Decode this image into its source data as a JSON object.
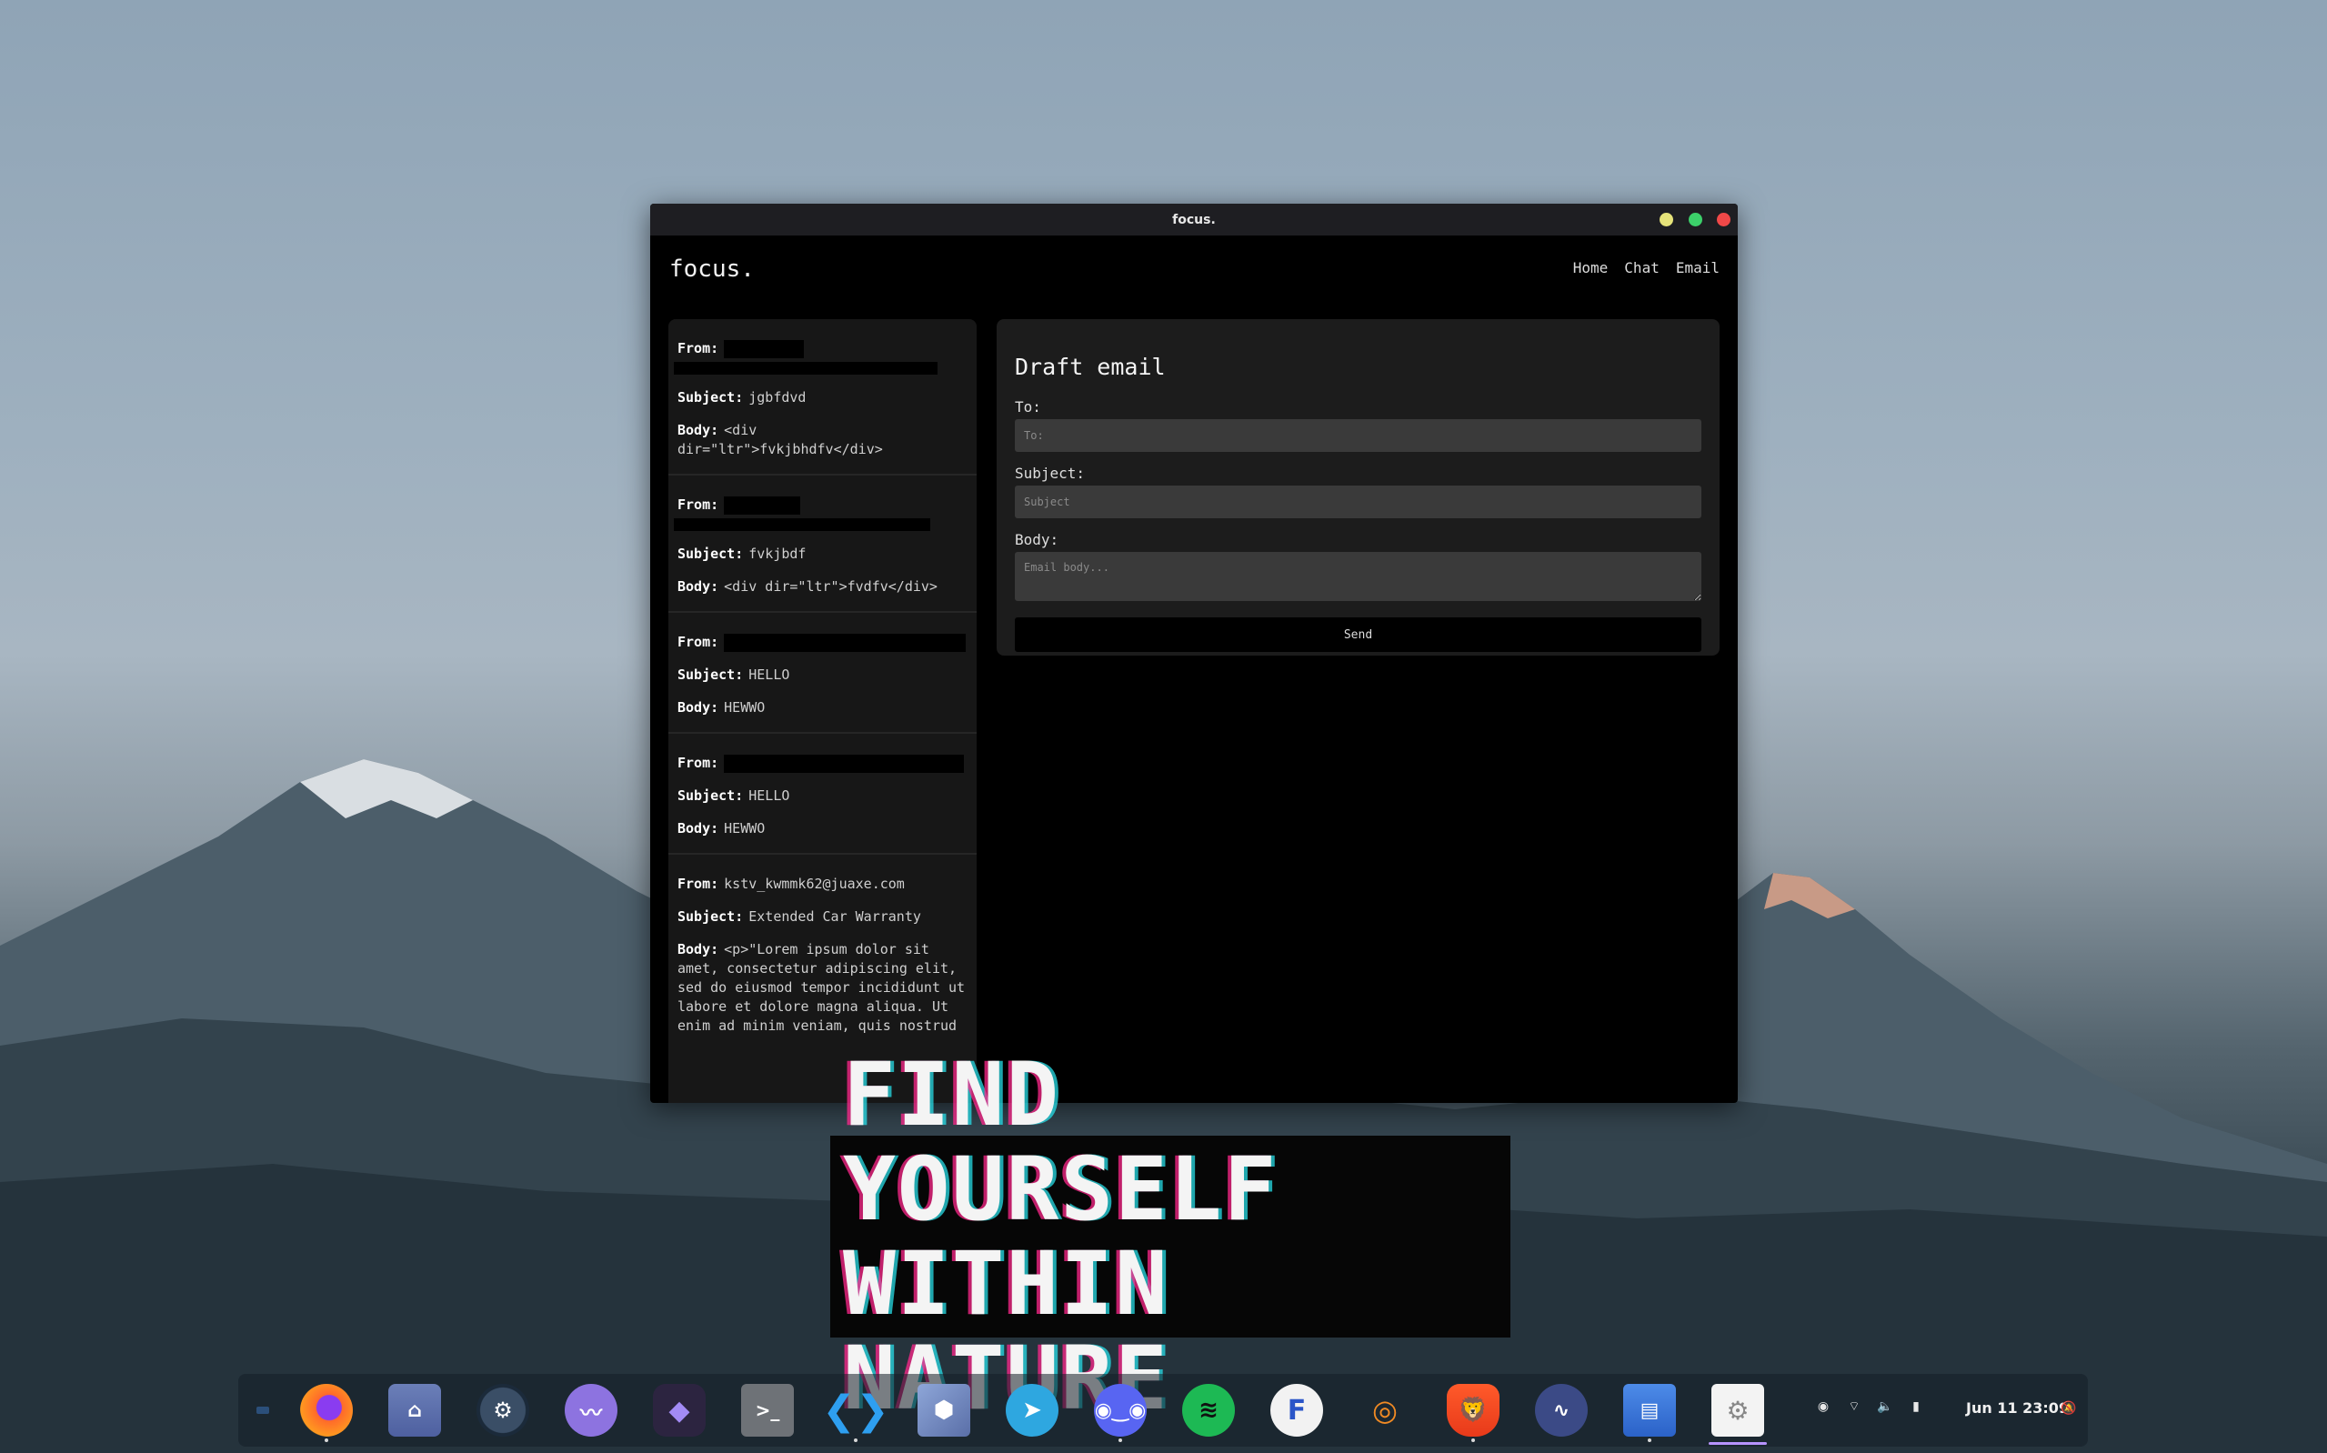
{
  "window": {
    "title": "focus."
  },
  "app": {
    "logo": "focus.",
    "nav": [
      "Home",
      "Chat",
      "Email"
    ]
  },
  "inbox": {
    "labels": {
      "from": "From:",
      "subject": "Subject:",
      "body": "Body:"
    },
    "emails": [
      {
        "from": "",
        "subject": "jgbfdvd",
        "body": "<div dir=\"ltr\">fvkjbhdfv</div>"
      },
      {
        "from": "",
        "subject": "fvkjbdf",
        "body": "<div dir=\"ltr\">fvdfv</div>"
      },
      {
        "from": "",
        "subject": "HELLO",
        "body": "HEWWO"
      },
      {
        "from": "",
        "subject": "HELLO",
        "body": "HEWWO"
      },
      {
        "from": "kstv_kwmmk62@juaxe.com",
        "subject": "Extended Car Warranty",
        "body": "<p>\"Lorem ipsum dolor sit amet, consectetur adipiscing elit, sed do eiusmod tempor incididunt ut labore et dolore magna aliqua. Ut enim ad minim veniam, quis nostrud"
      }
    ]
  },
  "draft": {
    "heading": "Draft email",
    "to_label": "To:",
    "to_placeholder": "To:",
    "subject_label": "Subject:",
    "subject_placeholder": "Subject",
    "body_label": "Body:",
    "body_placeholder": "Email body...",
    "send_label": "Send"
  },
  "banner": {
    "line1": "FIND YOURSELF",
    "line2": "WITHIN NATURE"
  },
  "dock": {
    "apps": [
      "firefox",
      "files",
      "steam",
      "mustache-app",
      "obsidian",
      "terminal",
      "vscode",
      "virtualbox",
      "telegram",
      "discord",
      "spotify",
      "flatseal",
      "blender",
      "brave",
      "system-monitor",
      "software-center",
      "settings"
    ],
    "clock": "Jun 11  23:09"
  },
  "colors": {
    "accent": "#b793ff",
    "window_bg": "#000000",
    "panel_bg": "#1c1c1c"
  }
}
